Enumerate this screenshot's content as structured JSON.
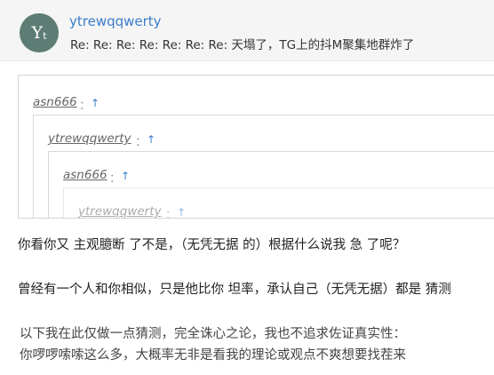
{
  "post": {
    "avatar_text": "Y",
    "avatar_sub": "t",
    "author": "ytrewqqwerty",
    "subject": "Re: Re: Re: Re: Re: Re: Re: 天塌了，TG上的抖M聚集地群炸了"
  },
  "quotes": [
    {
      "author": "asn666",
      "colon": "：",
      "arrow": "↑"
    },
    {
      "author": "ytrewqqwerty",
      "colon": "：",
      "arrow": "↑"
    },
    {
      "author": "asn666",
      "colon": "：",
      "arrow": "↑"
    },
    {
      "author": "ytrewqqwerty",
      "colon": "：",
      "arrow": "↑"
    }
  ],
  "body": {
    "line1": "你看你又 主观臆断 了不是，（无凭无据 的）根据什么说我 急 了呢？",
    "line2": "曾经有一个人和你相似，只是他比你 坦率，承认自己（无凭无据）都是 猜测",
    "line3": "以下我在此仅做一点猜测，完全诛心之论，我也不追求佐证真实性：",
    "line4": "你啰啰嗦嗦这么多，大概率无非是看我的理论或观点不爽想要找茬来"
  },
  "colors": {
    "link": "#3a7dc9",
    "avatar_bg": "#5c7c74",
    "header_bg": "#f5f5f5"
  }
}
